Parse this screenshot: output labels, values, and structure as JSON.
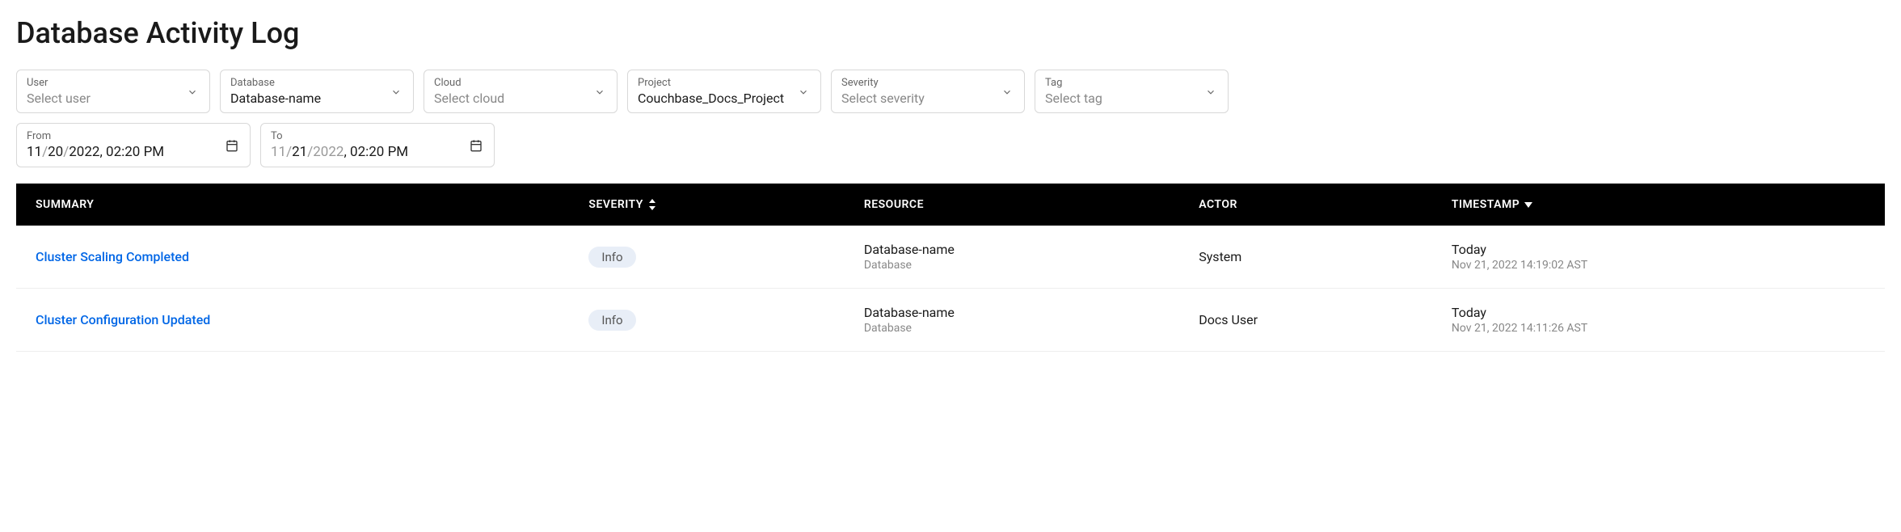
{
  "title": "Database Activity Log",
  "filters": {
    "user": {
      "label": "User",
      "value": "",
      "placeholder": "Select user"
    },
    "database": {
      "label": "Database",
      "value": "Database-name",
      "placeholder": ""
    },
    "cloud": {
      "label": "Cloud",
      "value": "",
      "placeholder": "Select cloud"
    },
    "project": {
      "label": "Project",
      "value": "Couchbase_Docs_Project",
      "placeholder": ""
    },
    "severity": {
      "label": "Severity",
      "value": "",
      "placeholder": "Select severity"
    },
    "tag": {
      "label": "Tag",
      "value": "",
      "placeholder": "Select tag"
    }
  },
  "dateFilters": {
    "from": {
      "label": "From",
      "month": "11",
      "day": "20",
      "year": "2022",
      "sep": "/",
      "comma": ", ",
      "time": "02:20 PM"
    },
    "to": {
      "label": "To",
      "month": "11",
      "day": "21",
      "year": "2022",
      "sep": "/",
      "comma": ", ",
      "time": "02:20 PM"
    }
  },
  "columns": {
    "summary": "SUMMARY",
    "severity": "SEVERITY",
    "resource": "RESOURCE",
    "actor": "ACTOR",
    "timestamp": "TIMESTAMP"
  },
  "rows": [
    {
      "summary": "Cluster Scaling Completed",
      "severity": "Info",
      "resourceName": "Database-name",
      "resourceType": "Database",
      "actor": "System",
      "timestampRelative": "Today",
      "timestampFull": "Nov 21, 2022 14:19:02 AST"
    },
    {
      "summary": "Cluster Configuration Updated",
      "severity": "Info",
      "resourceName": "Database-name",
      "resourceType": "Database",
      "actor": "Docs User",
      "timestampRelative": "Today",
      "timestampFull": "Nov 21, 2022 14:11:26 AST"
    }
  ]
}
